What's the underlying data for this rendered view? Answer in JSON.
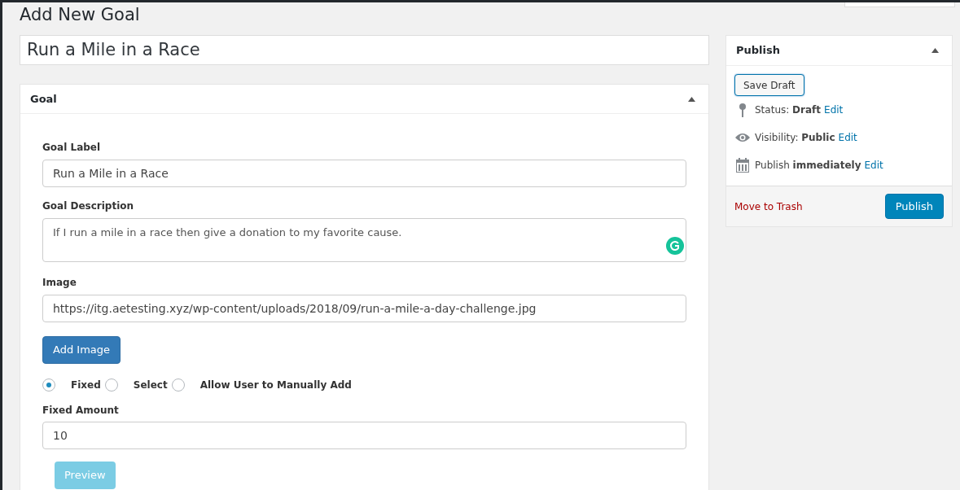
{
  "page_title": "Add New Goal",
  "post_title": "Run a Mile in a Race",
  "goal_box": {
    "title": "Goal",
    "expanded": true,
    "goal_label": {
      "label": "Goal Label",
      "value": "Run a Mile in a Race"
    },
    "goal_description": {
      "label": "Goal Description",
      "value": "If I run a mile in a race then give a donation to my favorite cause."
    },
    "image": {
      "label": "Image",
      "value": "https://itg.aetesting.xyz/wp-content/uploads/2018/09/run-a-mile-a-day-challenge.jpg"
    },
    "add_image_button": "Add Image",
    "amount_options": [
      {
        "label": "Fixed",
        "selected": true
      },
      {
        "label": "Select",
        "selected": false
      },
      {
        "label": "Allow User to Manually Add",
        "selected": false
      }
    ],
    "fixed_amount": {
      "label": "Fixed Amount",
      "value": "10"
    },
    "preview_button": {
      "label": "Preview",
      "disabled": true
    }
  },
  "publish_box": {
    "title": "Publish",
    "expanded": true,
    "save_draft": "Save Draft",
    "rows": [
      {
        "kind": "status",
        "text": "Status: **Draft**",
        "link": "Edit"
      },
      {
        "kind": "visibility",
        "text": "Visibility: **Public**",
        "link": "Edit"
      },
      {
        "kind": "schedule",
        "text": "Publish **immediately**",
        "link": "Edit"
      }
    ],
    "trash_link": "Move to Trash",
    "publish_button": "Publish"
  }
}
